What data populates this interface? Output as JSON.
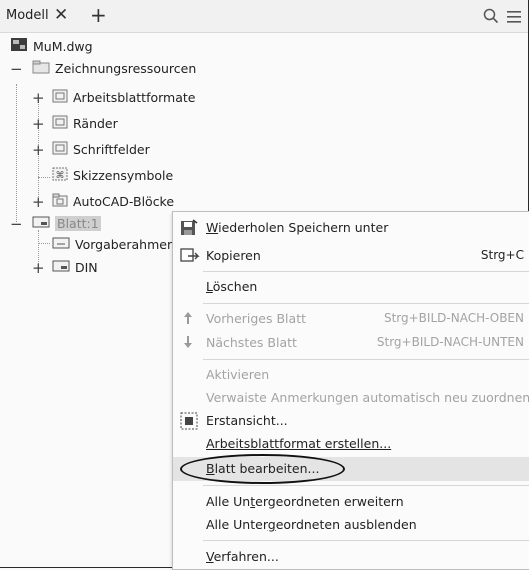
{
  "header": {
    "tab_label": "Modell",
    "close_glyph": "✕",
    "add_glyph": "+"
  },
  "tree": {
    "root": "MuM.dwg",
    "resources": "Zeichnungsressourcen",
    "resource_items": [
      "Arbeitsblattformate",
      "Ränder",
      "Schriftfelder",
      "Skizzensymbole",
      "AutoCAD-Blöcke"
    ],
    "sheet": "Blatt:1",
    "sheet_items": [
      "Vorgaberahmen",
      "DIN"
    ]
  },
  "context_menu": {
    "items": [
      {
        "label": "Wiederholen Speichern unter",
        "mnemonic": "W",
        "rest": "iederholen Speichern unter",
        "shortcut": "",
        "enabled": true
      },
      {
        "label": "Kopieren",
        "shortcut": "Strg+C",
        "enabled": true
      },
      {
        "label": "Löschen",
        "mnemonic": "L",
        "rest": "öschen",
        "shortcut": "",
        "enabled": true
      },
      {
        "label": "Vorheriges Blatt",
        "shortcut": "Strg+BILD-NACH-OBEN",
        "enabled": false
      },
      {
        "label": "Nächstes Blatt",
        "shortcut": "Strg+BILD-NACH-UNTEN",
        "enabled": false
      },
      {
        "label": "Aktivieren",
        "shortcut": "",
        "enabled": false
      },
      {
        "label": "Verwaiste Anmerkungen automatisch neu zuordnen",
        "shortcut": "",
        "enabled": false
      },
      {
        "label": "Erstansicht...",
        "shortcut": "",
        "enabled": true
      },
      {
        "label": "Arbeitsblattformat erstellen...",
        "shortcut": "",
        "enabled": true
      },
      {
        "label": "Blatt bearbeiten...",
        "mnemonic": "B",
        "rest": "latt bearbeiten...",
        "shortcut": "",
        "enabled": true
      },
      {
        "label": "Alle Untergeordneten erweitern",
        "pre": "Alle Un",
        "mnemonic": "t",
        "rest": "ergeordneten erweitern",
        "shortcut": "",
        "enabled": true
      },
      {
        "label": "Alle Untergeordneten ausblenden",
        "pre": "Alle Unter",
        "mnemonic": "g",
        "rest": "eordneten ausblenden",
        "shortcut": "",
        "enabled": true
      },
      {
        "label": "Verfahren...",
        "mnemonic": "V",
        "rest": "erfahren...",
        "shortcut": "",
        "enabled": true
      }
    ]
  },
  "colors": {
    "background": "#fafafa",
    "disabled_text": "#a3a3a3",
    "hover_row": "#e4e4e4",
    "highlight_outline": "#111111"
  }
}
